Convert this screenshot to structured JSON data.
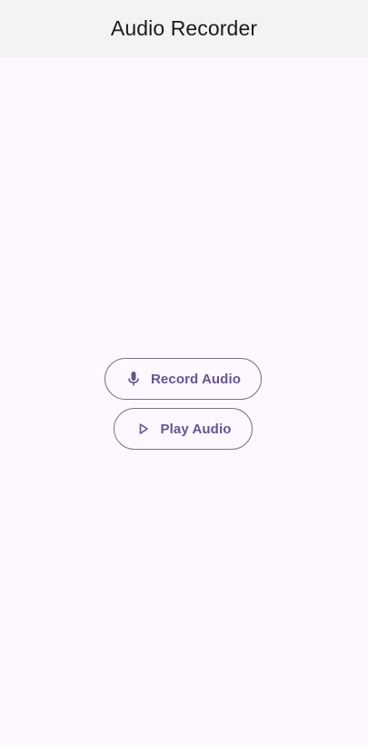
{
  "app_bar": {
    "title": "Audio Recorder"
  },
  "actions": {
    "record": {
      "label": "Record Audio",
      "icon": "mic-icon"
    },
    "play": {
      "label": "Play Audio",
      "icon": "play-icon"
    }
  },
  "colors": {
    "background": "#fef7ff",
    "app_bar": "#f3f2f4",
    "accent": "#65558f",
    "outline": "#79747e",
    "title_text": "#1d1b20"
  }
}
